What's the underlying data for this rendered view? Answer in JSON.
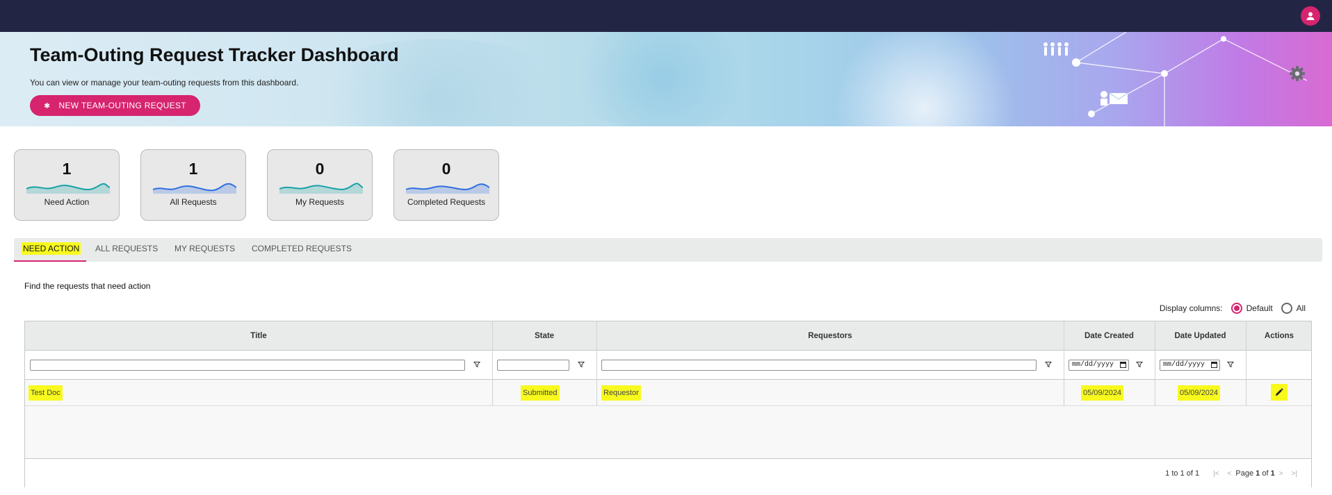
{
  "header": {
    "avatar_icon": "user-icon"
  },
  "banner": {
    "title": "Team-Outing Request Tracker Dashboard",
    "subtitle": "You can view or manage your team-outing requests from this dashboard.",
    "new_button_label": "NEW TEAM-OUTING REQUEST",
    "settings_icon": "gear-icon"
  },
  "cards": [
    {
      "value": "1",
      "label": "Need Action",
      "color": "#17a2a6"
    },
    {
      "value": "1",
      "label": "All Requests",
      "color": "#2f6fe0"
    },
    {
      "value": "0",
      "label": "My Requests",
      "color": "#17a2a6"
    },
    {
      "value": "0",
      "label": "Completed Requests",
      "color": "#2f6fe0"
    }
  ],
  "tabs": [
    {
      "label": "NEED ACTION",
      "active": true
    },
    {
      "label": "ALL REQUESTS",
      "active": false
    },
    {
      "label": "MY REQUESTS",
      "active": false
    },
    {
      "label": "COMPLETED REQUESTS",
      "active": false
    }
  ],
  "section": {
    "description": "Find the requests that need action"
  },
  "display_columns": {
    "label": "Display columns:",
    "option_default": "Default",
    "option_all": "All",
    "selected": "Default"
  },
  "table": {
    "columns": [
      "Title",
      "State",
      "Requestors",
      "Date Created",
      "Date Updated",
      "Actions"
    ],
    "date_placeholder": "mm/dd/yyyy",
    "rows": [
      {
        "title": "Test Doc",
        "state": "Submitted",
        "requestors": "Requestor",
        "date_created": "05/09/2024",
        "date_updated": "05/09/2024"
      }
    ],
    "pager": {
      "range": "1 to 1 of 1",
      "page_prefix": "Page",
      "page": "1",
      "of": "of",
      "total": "1"
    }
  },
  "colors": {
    "brand": "#d6246e",
    "topbar": "#232545",
    "highlight": "#f8fa1e"
  }
}
